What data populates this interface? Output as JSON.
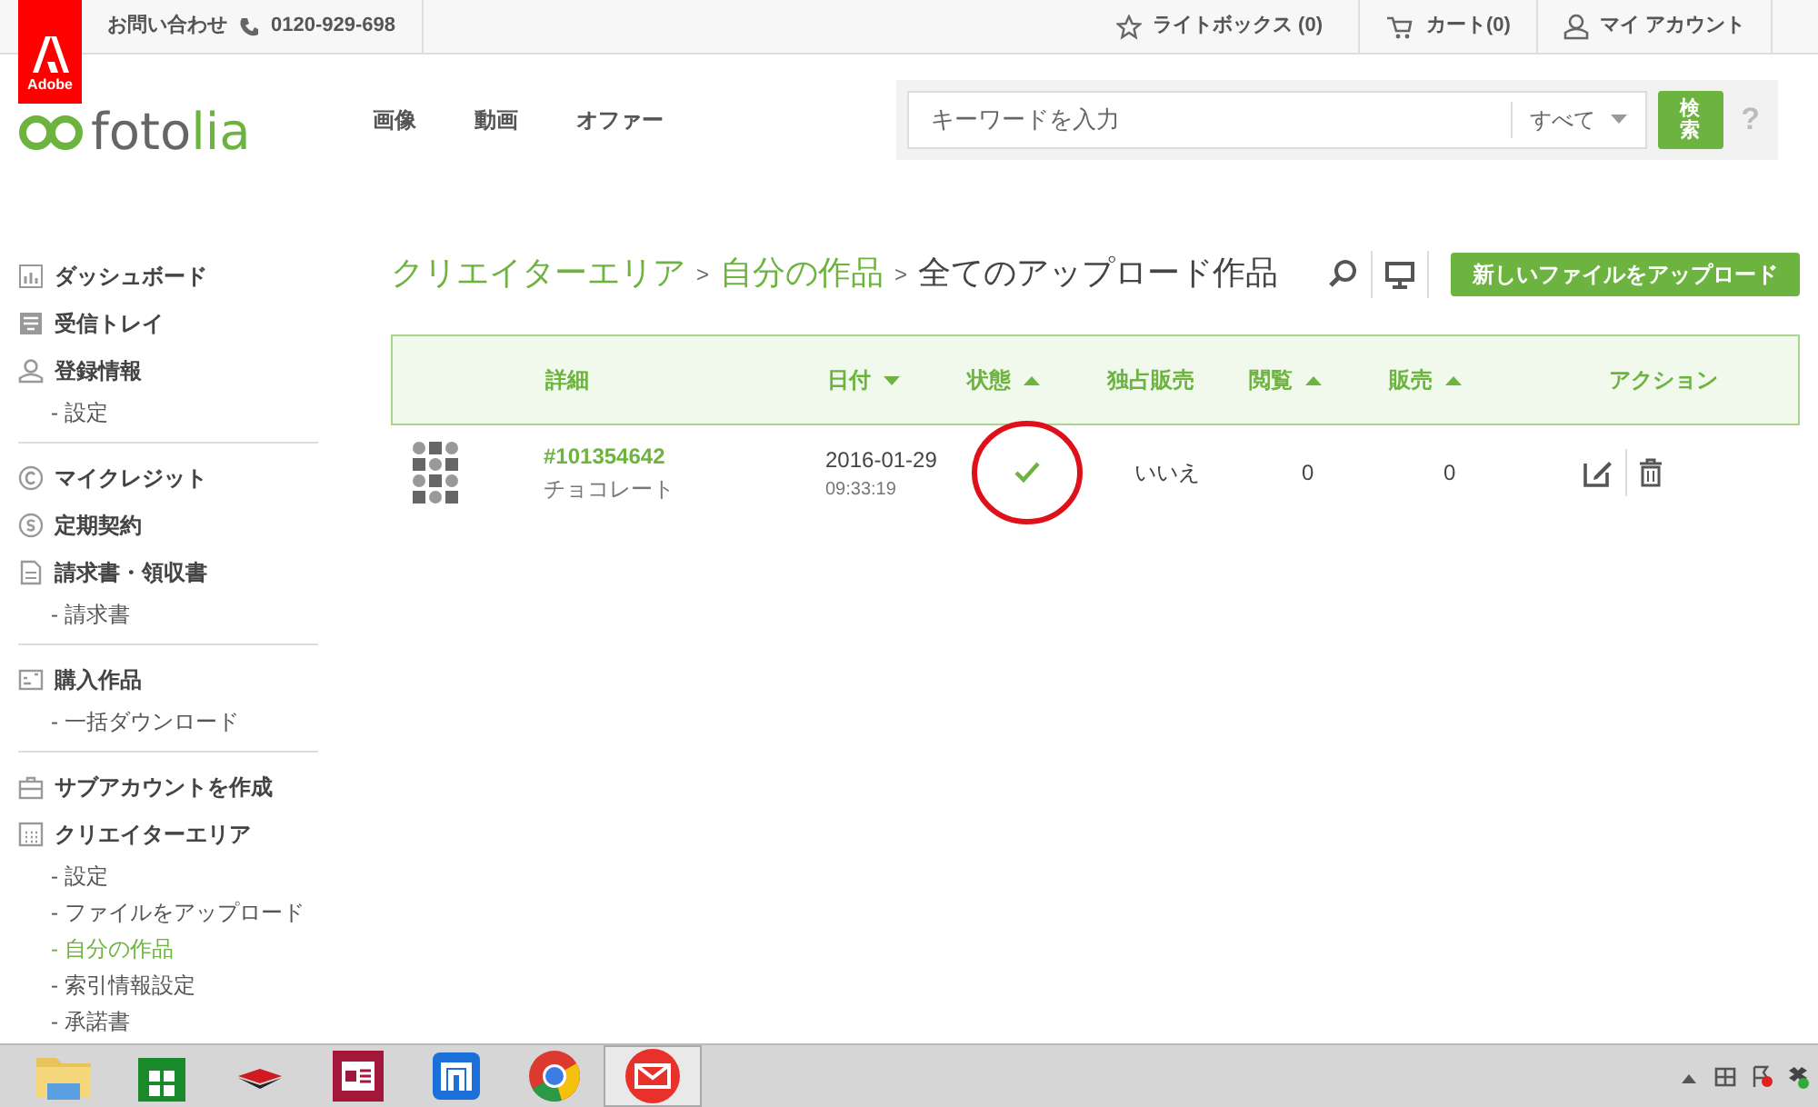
{
  "adobe_logo": {
    "label": "Adobe"
  },
  "top_bar": {
    "contact": "お問い合わせ",
    "phone": "0120-929-698",
    "lightbox": "ライトボックス (0)",
    "cart": "カート(0)",
    "account": "マイ アカウント"
  },
  "logo": {
    "part1": "foto",
    "part2": "lia"
  },
  "nav": [
    "画像",
    "動画",
    "オファー"
  ],
  "search": {
    "placeholder": "キーワードを入力",
    "scope": "すべて",
    "button": "検索",
    "help": "?"
  },
  "sidebar": [
    {
      "items": [
        {
          "label": "ダッシュボード",
          "kind": "chart"
        },
        {
          "label": "受信トレイ",
          "kind": "inbox"
        },
        {
          "label": "登録情報",
          "kind": "person",
          "children": [
            {
              "label": "- 設定",
              "selected": false
            }
          ]
        }
      ]
    },
    {
      "items": [
        {
          "label": "マイクレジット",
          "kind": "credit"
        },
        {
          "label": "定期契約",
          "kind": "subscription"
        },
        {
          "label": "請求書・領収書",
          "kind": "document",
          "children": [
            {
              "label": "- 請求書",
              "selected": false
            }
          ]
        }
      ]
    },
    {
      "items": [
        {
          "label": "購入作品",
          "kind": "image",
          "children": [
            {
              "label": "- 一括ダウンロード",
              "selected": false
            }
          ]
        }
      ]
    },
    {
      "items": [
        {
          "label": "サブアカウントを作成",
          "kind": "briefcase"
        },
        {
          "label": "クリエイターエリア",
          "kind": "calculator",
          "children": [
            {
              "label": "- 設定",
              "selected": false
            },
            {
              "label": "- ファイルをアップロード",
              "selected": false
            },
            {
              "label": "- 自分の作品",
              "selected": true
            },
            {
              "label": "- 索引情報設定",
              "selected": false
            },
            {
              "label": "- 承諾書",
              "selected": false
            }
          ]
        }
      ]
    }
  ],
  "breadcrumb": [
    {
      "label": "クリエイターエリア",
      "current": false
    },
    {
      "label": "自分の作品",
      "current": false
    },
    {
      "label": "全てのアップロード作品",
      "current": true
    }
  ],
  "breadcrumb_separator": ">",
  "upload_button": "新しいファイルをアップロード",
  "table": {
    "columns": [
      {
        "label": "詳細",
        "sortable": false
      },
      {
        "label": "日付",
        "sortable": true,
        "descending": true
      },
      {
        "label": "状態",
        "sortable": true,
        "descending": false
      },
      {
        "label": "独占販売",
        "sortable": false
      },
      {
        "label": "閲覧",
        "sortable": true,
        "descending": false
      },
      {
        "label": "販売",
        "sortable": true,
        "descending": false
      },
      {
        "label": "アクション",
        "sortable": false
      }
    ],
    "rows": [
      {
        "id": "#101354642",
        "title": "チョコレート",
        "date": "2016-01-29",
        "time": "09:33:19",
        "approved": true,
        "circled": true,
        "exclusive": "いいえ",
        "views": "0",
        "sales": "0"
      }
    ]
  },
  "taskbar": {
    "apps": [
      {
        "kind": "folder",
        "selected": false
      },
      {
        "kind": "store",
        "selected": false
      },
      {
        "kind": "device",
        "selected": false
      },
      {
        "kind": "news",
        "selected": false
      },
      {
        "kind": "maxthon",
        "selected": false
      },
      {
        "kind": "chrome",
        "selected": false
      },
      {
        "kind": "mail",
        "selected": true
      }
    ],
    "tray": [
      {
        "kind": "chevron"
      },
      {
        "kind": "windows"
      },
      {
        "kind": "flag"
      },
      {
        "kind": "dropbox"
      }
    ]
  }
}
